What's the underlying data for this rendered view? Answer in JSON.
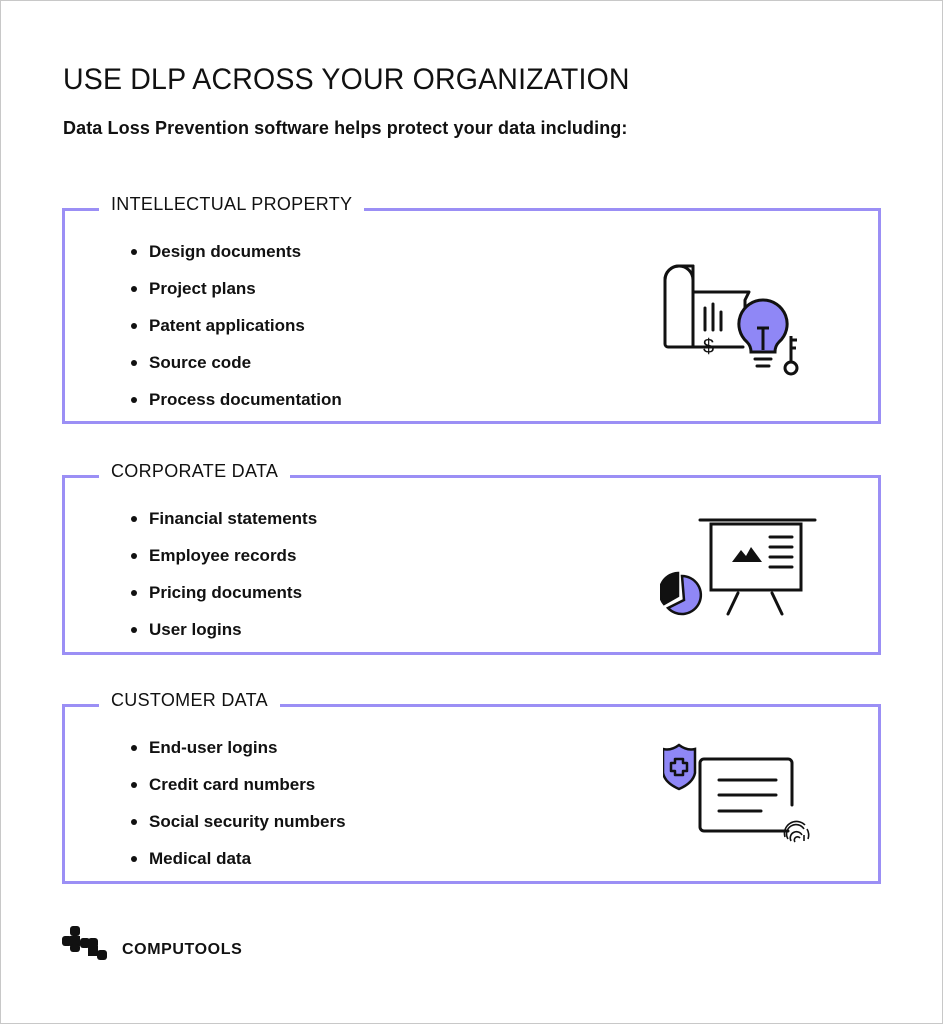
{
  "header": {
    "title": "USE DLP ACROSS YOUR ORGANIZATION",
    "subtitle": "Data Loss Prevention software helps protect your data including:"
  },
  "colors": {
    "accent": "#9b8ff5",
    "accent_fill": "#8f87f6",
    "text": "#111111"
  },
  "sections": [
    {
      "title": "INTELLECTUAL PROPERTY",
      "icon": "blueprint-lightbulb-key-icon",
      "items": [
        "Design documents",
        "Project plans",
        "Patent applications",
        "Source code",
        "Process documentation"
      ]
    },
    {
      "title": "CORPORATE DATA",
      "icon": "presentation-board-pie-chart-icon",
      "items": [
        "Financial statements",
        "Employee records",
        "Pricing documents",
        "User logins"
      ]
    },
    {
      "title": "CUSTOMER DATA",
      "icon": "shield-document-fingerprint-icon",
      "items": [
        "End-user logins",
        "Credit card numbers",
        "Social security numbers",
        "Medical data"
      ]
    }
  ],
  "footer": {
    "brand": "COMPUTOOLS"
  }
}
